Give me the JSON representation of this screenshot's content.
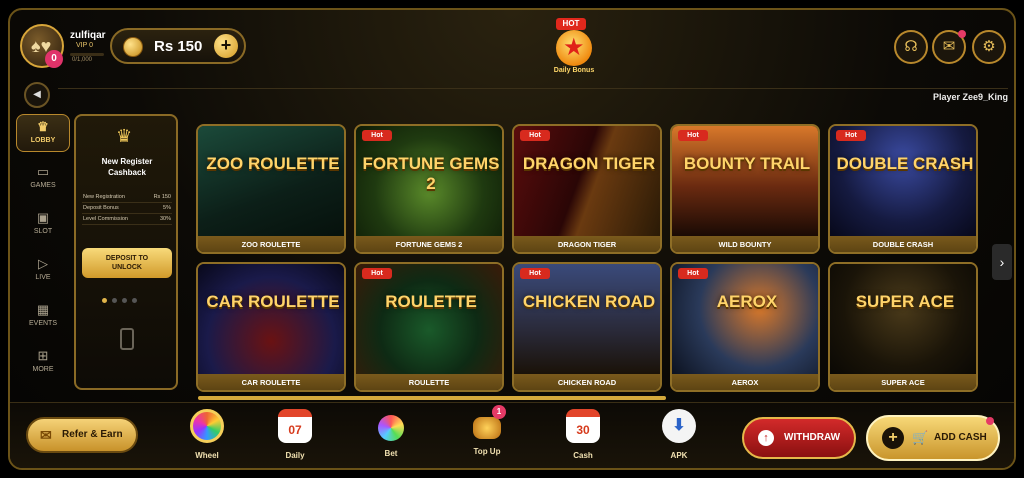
{
  "header": {
    "username": "zulfiqar",
    "vip": "VIP 0",
    "xp": "0/1,000",
    "xp_progress": 0,
    "avatar_badge": "0",
    "balance": "Rs 150",
    "daily_bonus": {
      "tag": "HOT",
      "label": "Daily Bonus"
    }
  },
  "subbar": {
    "player_text": "Player Zee9_King"
  },
  "sidenav": [
    {
      "label": "LOBBY",
      "icon": "crown-icon",
      "active": true
    },
    {
      "label": "GAMES",
      "icon": "gamepad-icon",
      "active": false
    },
    {
      "label": "SLOT",
      "icon": "slot-icon",
      "active": false
    },
    {
      "label": "LIVE",
      "icon": "play-icon",
      "active": false
    },
    {
      "label": "EVENTS",
      "icon": "calendar-icon",
      "active": false
    },
    {
      "label": "MORE",
      "icon": "grid-icon",
      "active": false
    }
  ],
  "promo": {
    "title_line1": "New Register",
    "title_line2": "Cashback",
    "rows": [
      {
        "key": "New Registration",
        "value": "Rs 150"
      },
      {
        "key": "Deposit Bonus",
        "value": "5%"
      },
      {
        "key": "Level Commission",
        "value": "30%"
      }
    ],
    "button_line1": "DEPOSIT TO",
    "button_line2": "UNLOCK"
  },
  "games": [
    {
      "name": "ZOO ROULETTE",
      "art": "ZOO ROULETTE",
      "hot": false
    },
    {
      "name": "FORTUNE GEMS 2",
      "art": "FORTUNE GEMS 2",
      "hot": true
    },
    {
      "name": "DRAGON TIGER",
      "art": "DRAGON TIGER",
      "hot": true
    },
    {
      "name": "WILD BOUNTY",
      "art": "BOUNTY TRAIL",
      "hot": true
    },
    {
      "name": "DOUBLE CRASH",
      "art": "DOUBLE CRASH",
      "hot": true
    },
    {
      "name": "CAR ROULETTE",
      "art": "CAR ROULETTE",
      "hot": false
    },
    {
      "name": "ROULETTE",
      "art": "ROULETTE",
      "hot": true
    },
    {
      "name": "CHICKEN ROAD",
      "art": "CHICKEN ROAD",
      "hot": true
    },
    {
      "name": "AEROX",
      "art": "AEROX",
      "hot": true
    },
    {
      "name": "SUPER ACE",
      "art": "SUPER ACE",
      "hot": false
    }
  ],
  "hot_label": "Hot",
  "bottom": {
    "refer": "Refer & Earn",
    "items": [
      {
        "label": "Wheel",
        "value": ""
      },
      {
        "label": "Daily",
        "value": "07"
      },
      {
        "label": "Bet",
        "value": ""
      },
      {
        "label": "Top Up",
        "value": "",
        "badge": "1"
      },
      {
        "label": "Cash",
        "value": "30"
      },
      {
        "label": "APK",
        "value": ""
      }
    ],
    "withdraw": "WITHDRAW",
    "add_cash": "ADD CASH"
  },
  "colors": {
    "gold": "#d8a63a",
    "red": "#d32a2a",
    "accent_pink": "#e53a66"
  }
}
